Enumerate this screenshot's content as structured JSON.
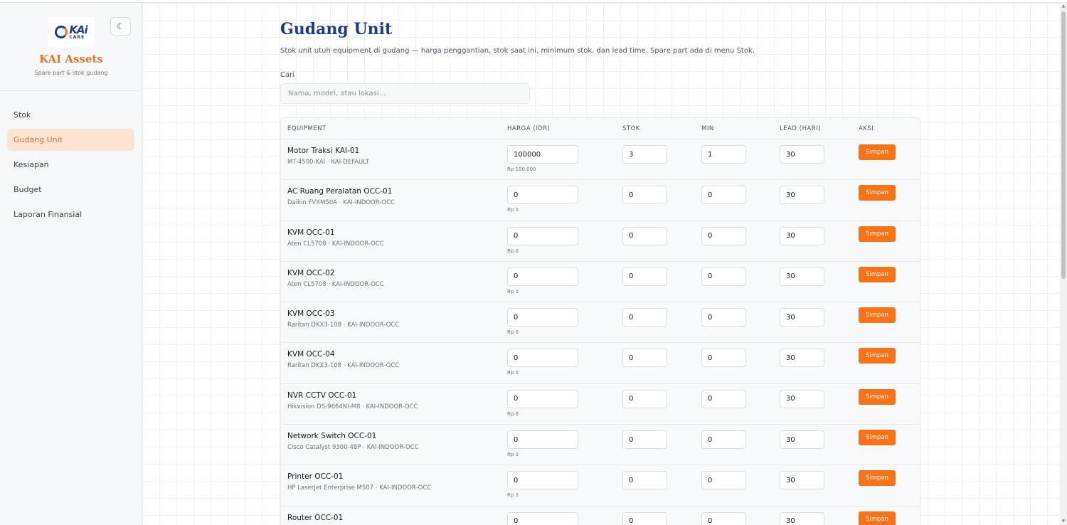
{
  "sidebar": {
    "brand_title": "KAI Assets",
    "brand_subtitle": "Spare part & stok gudang",
    "logo": {
      "kai": "KAi",
      "care": "CARE"
    },
    "theme_toggle_icon": "moon-icon",
    "items": [
      {
        "label": "Stok",
        "active": false
      },
      {
        "label": "Gudang Unit",
        "active": true
      },
      {
        "label": "Kesiapan",
        "active": false
      },
      {
        "label": "Budget",
        "active": false
      },
      {
        "label": "Laporan Finansial",
        "active": false
      }
    ]
  },
  "main": {
    "title": "Gudang Unit",
    "description": "Stok unit utuh equipment di gudang — harga penggantian, stok saat ini, minimum stok, dan lead time. Spare part ada di menu Stok.",
    "search": {
      "label": "Cari",
      "placeholder": "Nama, model, atau lokasi...",
      "value": ""
    }
  },
  "table": {
    "headers": [
      "EQUIPMENT",
      "HARGA (IDR)",
      "STOK",
      "MIN",
      "LEAD (HARI)",
      "AKSI"
    ],
    "action_label": "Simpan",
    "rows": [
      {
        "name": "Motor Traksi KAI-01",
        "sub": "MT-4500-KAI · KAI-DEFAULT",
        "price": "100000",
        "price_fmt": "Rp 100.000",
        "stock": "3",
        "min": "1",
        "lead": "30"
      },
      {
        "name": "AC Ruang Peralatan OCC-01",
        "sub": "Daikin FVXM50A · KAI-INDOOR-OCC",
        "price": "0",
        "price_fmt": "Rp 0",
        "stock": "0",
        "min": "0",
        "lead": "30"
      },
      {
        "name": "KVM OCC-01",
        "sub": "Aten CL5708 · KAI-INDOOR-OCC",
        "price": "0",
        "price_fmt": "Rp 0",
        "stock": "0",
        "min": "0",
        "lead": "30"
      },
      {
        "name": "KVM OCC-02",
        "sub": "Aten CL5708 · KAI-INDOOR-OCC",
        "price": "0",
        "price_fmt": "Rp 0",
        "stock": "0",
        "min": "0",
        "lead": "30"
      },
      {
        "name": "KVM OCC-03",
        "sub": "Raritan DKX3-108 · KAI-INDOOR-OCC",
        "price": "0",
        "price_fmt": "Rp 0",
        "stock": "0",
        "min": "0",
        "lead": "30"
      },
      {
        "name": "KVM OCC-04",
        "sub": "Raritan DKX3-108 · KAI-INDOOR-OCC",
        "price": "0",
        "price_fmt": "Rp 0",
        "stock": "0",
        "min": "0",
        "lead": "30"
      },
      {
        "name": "NVR CCTV OCC-01",
        "sub": "Hikvision DS-9664NI-M8 · KAI-INDOOR-OCC",
        "price": "0",
        "price_fmt": "Rp 0",
        "stock": "0",
        "min": "0",
        "lead": "30"
      },
      {
        "name": "Network Switch OCC-01",
        "sub": "Cisco Catalyst 9300-48P · KAI-INDOOR-OCC",
        "price": "0",
        "price_fmt": "Rp 0",
        "stock": "0",
        "min": "0",
        "lead": "30"
      },
      {
        "name": "Printer OCC-01",
        "sub": "HP LaserJet Enterprise M507 · KAI-INDOOR-OCC",
        "price": "0",
        "price_fmt": "Rp 0",
        "stock": "0",
        "min": "0",
        "lead": "30"
      },
      {
        "name": "Router OCC-01",
        "sub": "",
        "price": "0",
        "price_fmt": "",
        "stock": "0",
        "min": "0",
        "lead": "30"
      }
    ]
  }
}
